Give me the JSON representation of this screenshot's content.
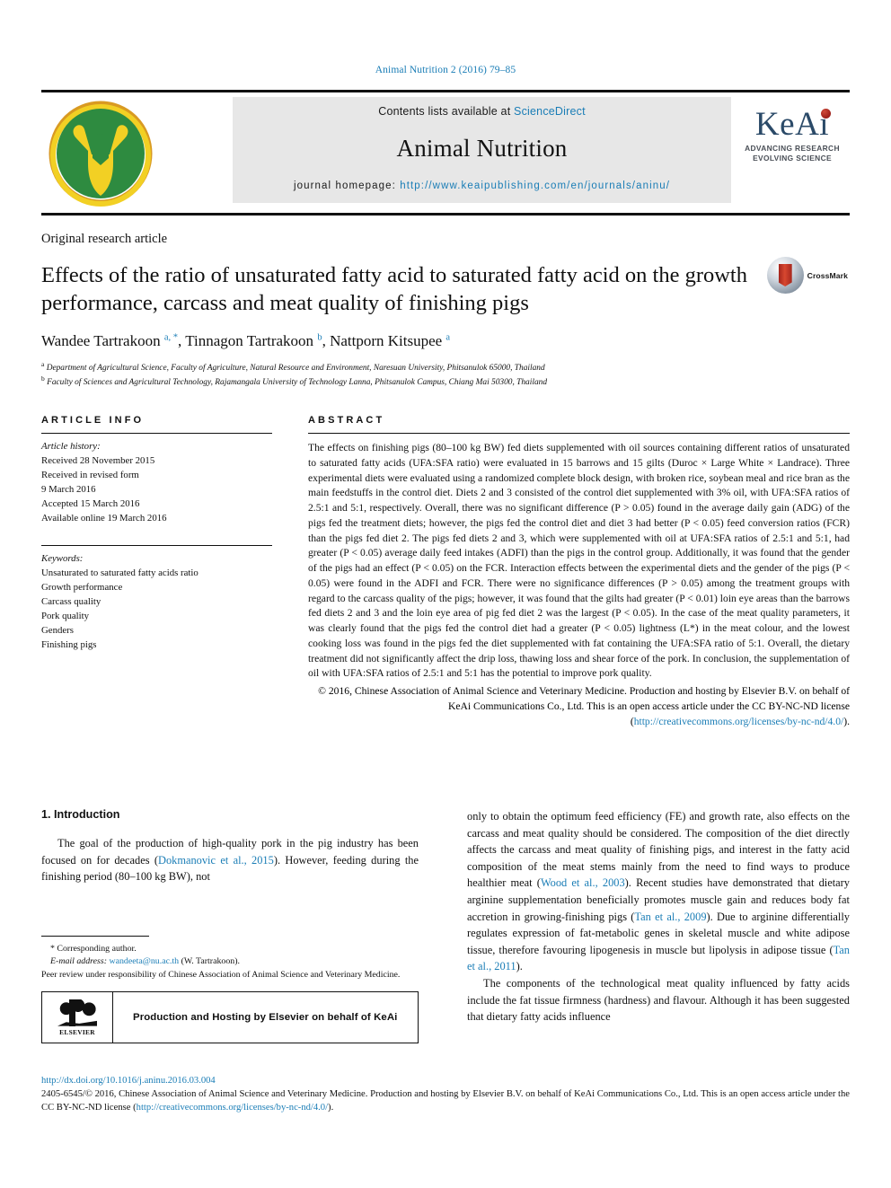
{
  "running_head": "Animal Nutrition 2 (2016) 79–85",
  "masthead": {
    "contents_prefix": "Contents lists available at ",
    "contents_link": "ScienceDirect",
    "journal_title": "Animal Nutrition",
    "homepage_prefix": "journal homepage: ",
    "homepage_link": "http://www.keaipublishing.com/en/journals/aninu/",
    "keai_wordmark": "KeAi",
    "keai_tagline_1": "ADVANCING RESEARCH",
    "keai_tagline_2": "EVOLVING SCIENCE"
  },
  "title_block": {
    "article_type": "Original research article",
    "title": "Effects of the ratio of unsaturated fatty acid to saturated fatty acid on the growth performance, carcass and meat quality of finishing pigs",
    "authors_html": "Wandee Tartrakoon <sup>a, *</sup>, Tinnagon Tartrakoon <sup>b</sup>, Nattporn Kitsupee <sup>a</sup>",
    "affiliation_a": "Department of Agricultural Science, Faculty of Agriculture, Natural Resource and Environment, Naresuan University, Phitsanulok 65000, Thailand",
    "affiliation_b": "Faculty of Sciences and Agricultural Technology, Rajamangala University of Technology Lanna, Phitsanulok Campus, Chiang Mai 50300, Thailand",
    "crossmark_label": "CrossMark"
  },
  "article_info": {
    "heading": "ARTICLE INFO",
    "history_label": "Article history:",
    "history": [
      "Received 28 November 2015",
      "Received in revised form",
      "9 March 2016",
      "Accepted 15 March 2016",
      "Available online 19 March 2016"
    ],
    "keywords_label": "Keywords:",
    "keywords": [
      "Unsaturated to saturated fatty acids ratio",
      "Growth performance",
      "Carcass quality",
      "Pork quality",
      "Genders",
      "Finishing pigs"
    ]
  },
  "abstract": {
    "heading": "ABSTRACT",
    "text": "The effects on finishing pigs (80–100 kg BW) fed diets supplemented with oil sources containing different ratios of unsaturated to saturated fatty acids (UFA:SFA ratio) were evaluated in 15 barrows and 15 gilts (Duroc × Large White × Landrace). Three experimental diets were evaluated using a randomized complete block design, with broken rice, soybean meal and rice bran as the main feedstuffs in the control diet. Diets 2 and 3 consisted of the control diet supplemented with 3% oil, with UFA:SFA ratios of 2.5:1 and 5:1, respectively. Overall, there was no significant difference (P > 0.05) found in the average daily gain (ADG) of the pigs fed the treatment diets; however, the pigs fed the control diet and diet 3 had better (P < 0.05) feed conversion ratios (FCR) than the pigs fed diet 2. The pigs fed diets 2 and 3, which were supplemented with oil at UFA:SFA ratios of 2.5:1 and 5:1, had greater (P < 0.05) average daily feed intakes (ADFI) than the pigs in the control group. Additionally, it was found that the gender of the pigs had an effect (P < 0.05) on the FCR. Interaction effects between the experimental diets and the gender of the pigs (P < 0.05) were found in the ADFI and FCR. There were no significance differences (P > 0.05) among the treatment groups with regard to the carcass quality of the pigs; however, it was found that the gilts had greater (P < 0.01) loin eye areas than the barrows fed diets 2 and 3 and the loin eye area of pig fed diet 2 was the largest (P < 0.05). In the case of the meat quality parameters, it was clearly found that the pigs fed the control diet had a greater (P < 0.05) lightness (L*) in the meat colour, and the lowest cooking loss was found in the pigs fed the diet supplemented with fat containing the UFA:SFA ratio of 5:1. Overall, the dietary treatment did not significantly affect the drip loss, thawing loss and shear force of the pork. In conclusion, the supplementation of oil with UFA:SFA ratios of 2.5:1 and 5:1 has the potential to improve pork quality.",
    "copyright_text": "© 2016, Chinese Association of Animal Science and Veterinary Medicine. Production and hosting by Elsevier B.V. on behalf of KeAi Communications Co., Ltd. This is an open access article under the CC BY-NC-ND license (",
    "copyright_link": "http://creativecommons.org/licenses/by-nc-nd/4.0/",
    "copyright_tail": ")."
  },
  "introduction": {
    "heading": "1. Introduction",
    "left_para_1_a": "The goal of the production of high-quality pork in the pig industry has been focused on for decades (",
    "left_cite_1": "Dokmanovic et al., 2015",
    "left_para_1_b": "). However, feeding during the finishing period (80–100 kg BW), not",
    "right_para_1_a": "only to obtain the optimum feed efficiency (FE) and growth rate, also effects on the carcass and meat quality should be considered. The composition of the diet directly affects the carcass and meat quality of finishing pigs, and interest in the fatty acid composition of the meat stems mainly from the need to find ways to produce healthier meat (",
    "right_cite_1": "Wood et al., 2003",
    "right_para_1_b": "). Recent studies have demonstrated that dietary arginine supplementation beneficially promotes muscle gain and reduces body fat accretion in growing-finishing pigs (",
    "right_cite_2": "Tan et al., 2009",
    "right_para_1_c": "). Due to arginine differentially regulates expression of fat-metabolic genes in skeletal muscle and white adipose tissue, therefore favouring lipogenesis in muscle but lipolysis in adipose tissue (",
    "right_cite_3": "Tan et al., 2011",
    "right_para_1_d": ").",
    "right_para_2": "The components of the technological meat quality influenced by fatty acids include the fat tissue firmness (hardness) and flavour. Although it has been suggested that dietary fatty acids influence"
  },
  "footnote": {
    "corresponding_marker": "*",
    "corresponding_label": "Corresponding author.",
    "email_label": "E-mail address:",
    "email": "wandeeta@nu.ac.th",
    "email_suffix": "(W. Tartrakoon).",
    "peer_review": "Peer review under responsibility of Chinese Association of Animal Science and Veterinary Medicine.",
    "elsevier_box_text": "Production and Hosting by Elsevier on behalf of KeAi",
    "elsevier_wordmark": "ELSEVIER"
  },
  "page_footer": {
    "doi": "http://dx.doi.org/10.1016/j.aninu.2016.03.004",
    "copyright_a": "2405-6545/© 2016, Chinese Association of Animal Science and Veterinary Medicine. Production and hosting by Elsevier B.V. on behalf of KeAi Communications Co., Ltd. This is an open access article under the CC BY-NC-ND license (",
    "copyright_link": "http://creativecommons.org/licenses/by-nc-nd/4.0/",
    "copyright_b": ")."
  },
  "colors": {
    "link": "#1a7db6",
    "logo_green": "#2e8b40",
    "logo_yellow": "#f2d024",
    "logo_orange": "#d99a22",
    "keai_navy": "#2b4a68",
    "crossmark_red": "#c0392b"
  }
}
